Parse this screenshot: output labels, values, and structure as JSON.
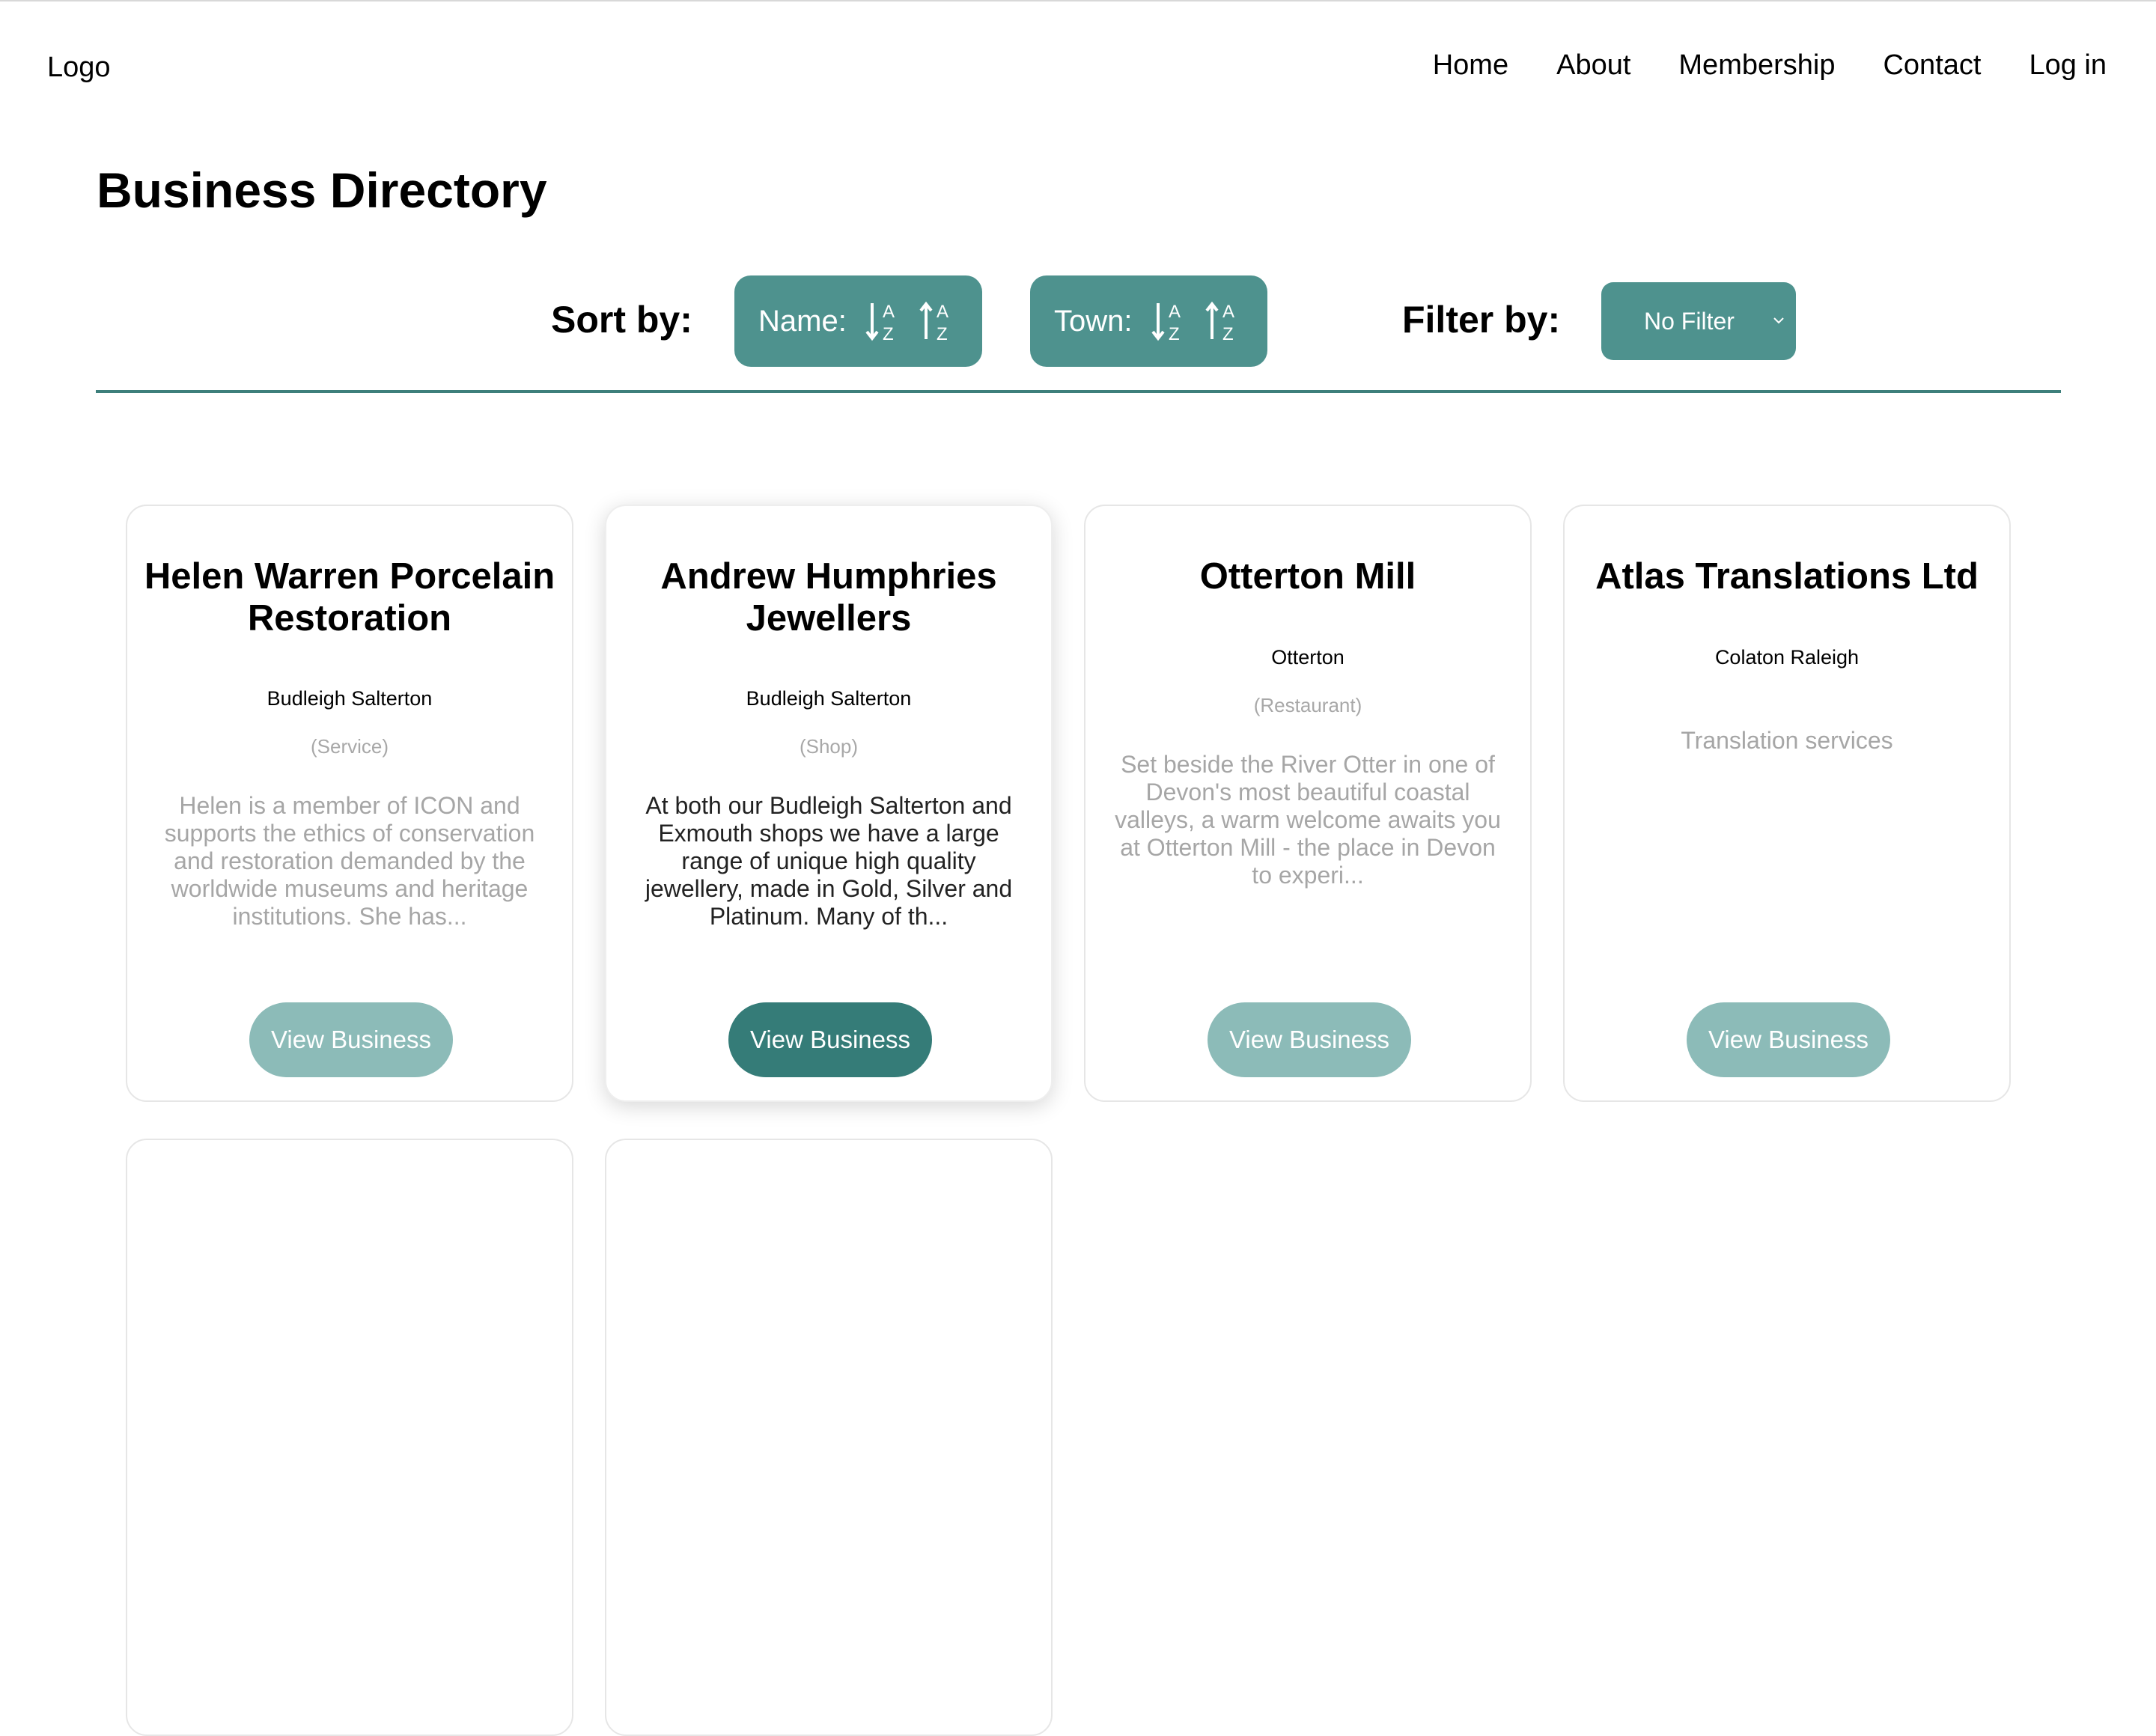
{
  "header": {
    "logo": "Logo",
    "nav": [
      "Home",
      "About",
      "Membership",
      "Contact",
      "Log in"
    ]
  },
  "page": {
    "title": "Business Directory"
  },
  "sort": {
    "label": "Sort by:",
    "name_label": "Name:",
    "town_label": "Town:",
    "icons": [
      "sort-ascending-az-icon",
      "sort-descending-az-icon"
    ]
  },
  "filter": {
    "label": "Filter by:",
    "selected": "No Filter"
  },
  "colors": {
    "accent": "#4e928e",
    "button_muted": "#8cbbb8",
    "button_active": "#357c78"
  },
  "cards": [
    {
      "name": "Helen Warren Porcelain Restoration",
      "town": "Budleigh Salterton",
      "category": "(Service)",
      "description": "Helen is a member of ICON and supports the ethics of conservation and restoration demanded by the worldwide museums and heritage institutions. She has...",
      "button": "View Business"
    },
    {
      "name": "Andrew Humphries Jewellers",
      "town": "Budleigh Salterton",
      "category": "(Shop)",
      "description": "At both our Budleigh Salterton and Exmouth shops we have a large range of unique high quality jewellery, made in Gold, Silver and Platinum. Many of th...",
      "button": "View Business"
    },
    {
      "name": "Otterton Mill",
      "town": "Otterton",
      "category": "(Restaurant)",
      "description": "Set beside the River Otter in one of Devon's most beautiful coastal valleys, a warm welcome awaits you at Otterton Mill - the place in Devon to experi...",
      "button": "View Business"
    },
    {
      "name": "Atlas Translations Ltd",
      "town": "Colaton Raleigh",
      "description": "Translation services",
      "button": "View Business"
    }
  ]
}
